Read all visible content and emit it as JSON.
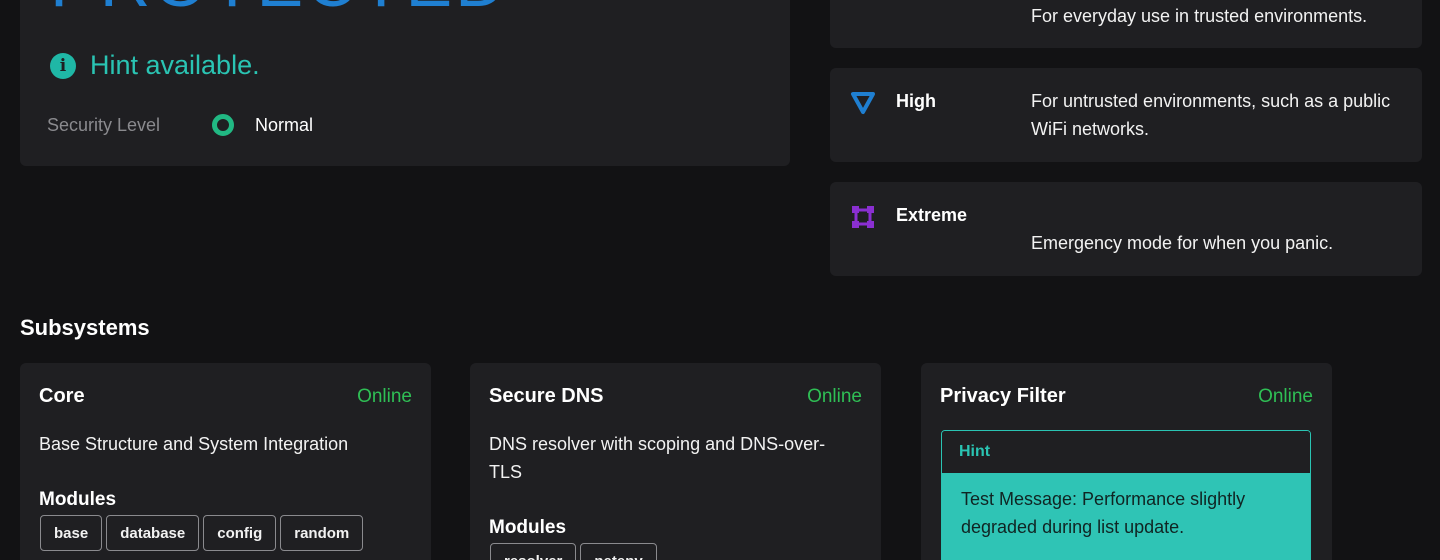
{
  "status": {
    "title": "PROTECTED",
    "hint": "Hint available.",
    "level_label": "Security Level",
    "level_value": "Normal"
  },
  "levels": [
    {
      "name": "",
      "description": "For everyday use in trusted environments.",
      "icon": "ring-icon"
    },
    {
      "name": "High",
      "description": "For untrusted environments, such as a public WiFi networks.",
      "icon": "triangle-down-icon",
      "color": "#1f7fd1"
    },
    {
      "name": "Extreme",
      "description": "Emergency mode for when you panic.",
      "icon": "frame-icon",
      "color": "#8a2fd1"
    }
  ],
  "subsystems_title": "Subsystems",
  "subsystems": [
    {
      "name": "Core",
      "status": "Online",
      "description": "Base Structure and System Integration",
      "modules_label": "Modules",
      "modules": [
        "base",
        "database",
        "config",
        "random"
      ]
    },
    {
      "name": "Secure DNS",
      "status": "Online",
      "description": "DNS resolver with scoping and DNS-over-TLS",
      "modules_label": "Modules",
      "modules": [
        "resolver",
        "netenv"
      ]
    },
    {
      "name": "Privacy Filter",
      "status": "Online",
      "hint_title": "Hint",
      "hint_message": "Test Message: Performance slightly degraded during list update."
    }
  ],
  "colors": {
    "accent_blue": "#1f7fd1",
    "hint_teal": "#2ac4b3",
    "online_green": "#2fbf55",
    "normal_green": "#21b883"
  }
}
